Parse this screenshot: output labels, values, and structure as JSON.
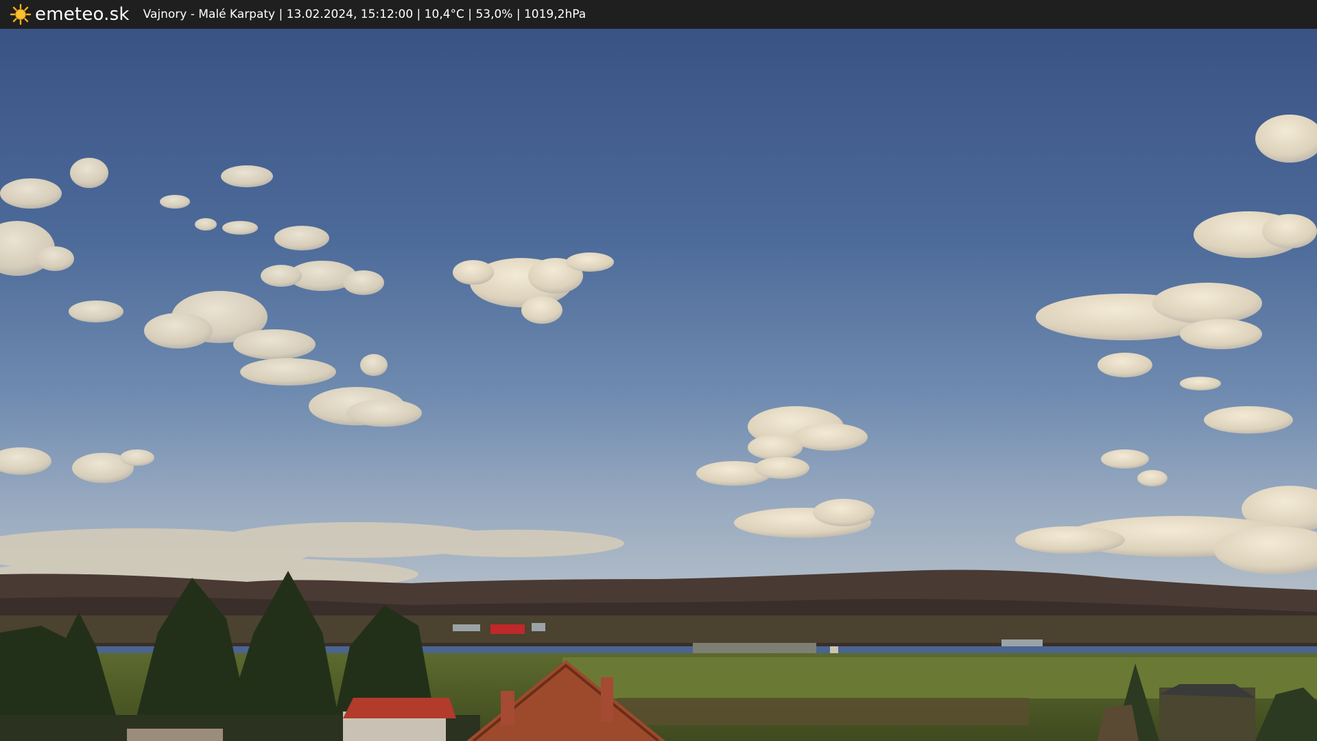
{
  "header": {
    "logo_text": "emeteo.sk",
    "logo_icon": "sun-icon",
    "caption": "Vajnory - Malé Karpaty | 13.02.2024, 15:12:00 | 10,4°C | 53,0% | 1019,2hPa"
  },
  "colors": {
    "bar_background": "#1f1f1f",
    "sky_top": "#3b5586",
    "sky_horizon": "#a9b6c4",
    "sun_icon": "#f5b31c"
  }
}
